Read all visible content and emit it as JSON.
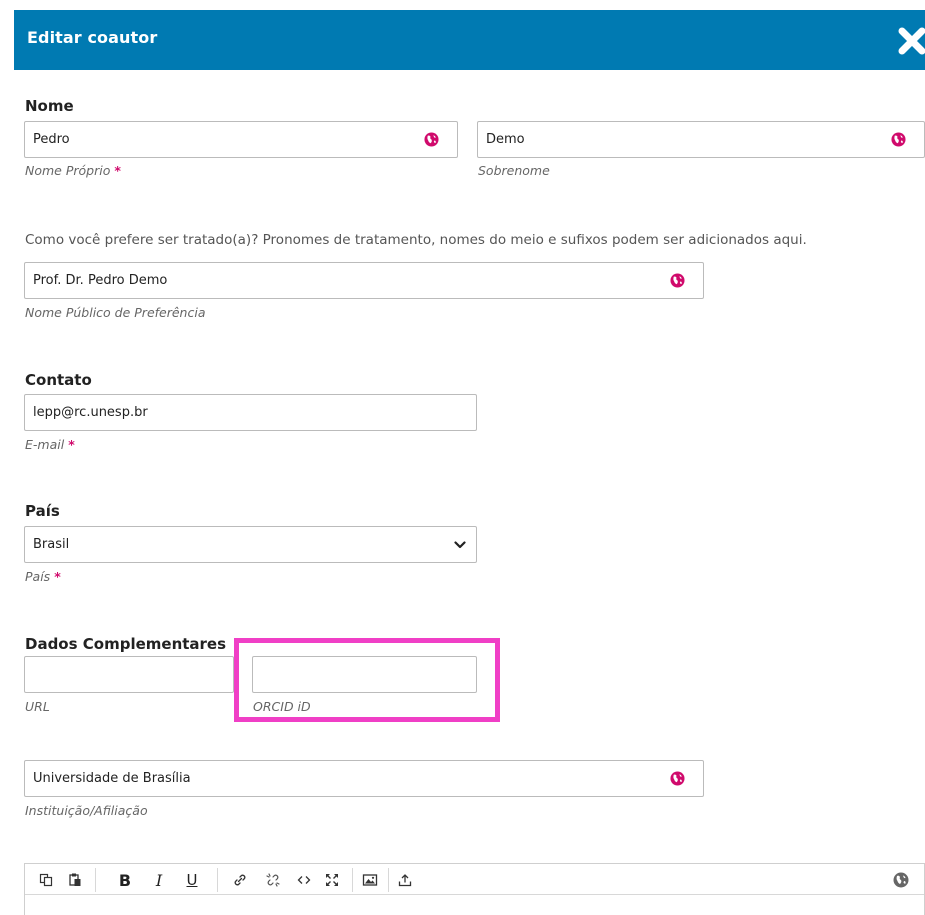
{
  "dialog": {
    "title": "Editar coautor"
  },
  "name_section": {
    "title": "Nome",
    "given_name": {
      "value": "Pedro",
      "label": "Nome Próprio",
      "required": "*"
    },
    "family_name": {
      "value": "Demo",
      "label": "Sobrenome"
    },
    "preferred_help": "Como você prefere ser tratado(a)? Pronomes de tratamento, nomes do meio e sufixos podem ser adicionados aqui.",
    "preferred_name": {
      "value": "Prof. Dr. Pedro Demo",
      "label": "Nome Público de Preferência"
    }
  },
  "contact_section": {
    "title": "Contato",
    "email": {
      "value": "lepp@rc.unesp.br",
      "label": "E-mail",
      "required": "*"
    }
  },
  "country_section": {
    "title": "País",
    "country": {
      "value": "Brasil",
      "label": "País",
      "required": "*"
    }
  },
  "extra_section": {
    "title": "Dados Complementares",
    "url": {
      "value": "",
      "label": "URL"
    },
    "orcid": {
      "value": "",
      "label": "ORCID iD"
    }
  },
  "affiliation": {
    "value": "Universidade de Brasília",
    "label": "Instituição/Afiliação"
  },
  "colors": {
    "header": "#007ab2",
    "accent": "#d00a6c",
    "highlight": "#f03fc6"
  },
  "icons": {
    "close": "close-icon",
    "globe": "globe-icon",
    "chevron": "chevron-down-icon",
    "toolbar": [
      "copy-icon",
      "paste-icon",
      "bold-icon",
      "italic-icon",
      "underline-icon",
      "link-icon",
      "unlink-icon",
      "code-icon",
      "fullscreen-icon",
      "image-icon",
      "upload-icon",
      "globe-icon"
    ]
  },
  "toolbar": {
    "bold": "B",
    "italic": "I",
    "underline": "U"
  }
}
